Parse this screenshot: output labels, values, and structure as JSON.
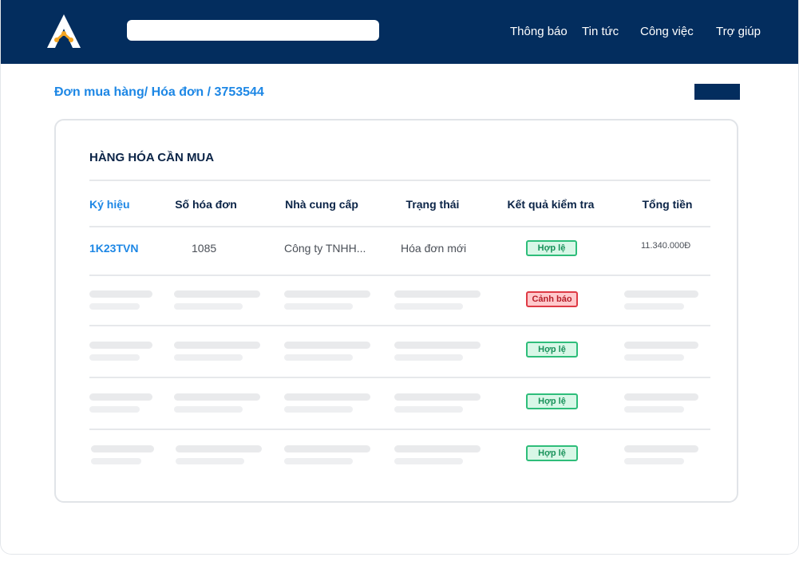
{
  "colors": {
    "header_bg": "#032d5e",
    "accent_blue": "#1d87e5",
    "valid_green": "#2ebd7a",
    "warning_red": "#de3a45"
  },
  "header": {
    "logo": "logo-a-icon",
    "search": {
      "value": "",
      "placeholder": ""
    },
    "nav": [
      "Thông báo",
      "Tin tức",
      "Công việc",
      "Trợ giúp"
    ]
  },
  "page": {
    "breadcrumb": "Đơn mua hàng/ Hóa đơn / 3753544"
  },
  "card": {
    "title": "HÀNG HÓA CẦN MUA",
    "columns": [
      "Ký hiệu",
      "Số hóa đơn",
      "Nhà cung cấp",
      "Trạng thái",
      "Kết quả kiểm tra",
      "Tổng tiền"
    ],
    "rows": [
      {
        "symbol": "1K23TVN",
        "invoice_no": "1085",
        "supplier": "Công ty TNHH...",
        "status": "Hóa đơn mới",
        "check_result": "Hợp lệ",
        "total": "11.340.000Đ"
      },
      {
        "check_result": "Cảnh báo"
      },
      {
        "check_result": "Hợp lệ"
      },
      {
        "check_result": "Hợp lệ"
      },
      {
        "check_result": "Hợp lệ"
      }
    ]
  }
}
